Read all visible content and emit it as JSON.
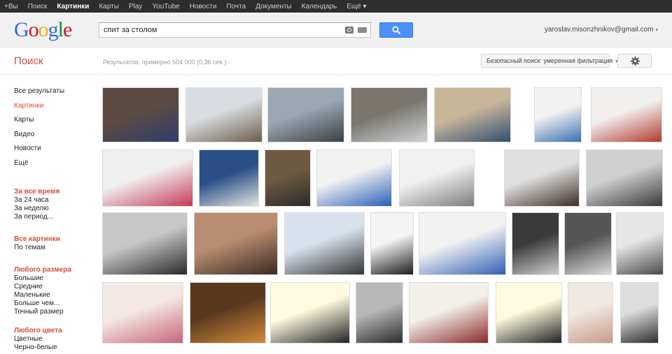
{
  "topbar": {
    "items": [
      {
        "label": "+Вы",
        "active": false
      },
      {
        "label": "Поиск",
        "active": false
      },
      {
        "label": "Картинки",
        "active": true
      },
      {
        "label": "Карты",
        "active": false
      },
      {
        "label": "Play",
        "active": false
      },
      {
        "label": "YouTube",
        "active": false
      },
      {
        "label": "Новости",
        "active": false
      },
      {
        "label": "Почта",
        "active": false
      },
      {
        "label": "Документы",
        "active": false
      },
      {
        "label": "Календарь",
        "active": false
      },
      {
        "label": "Ещё ▾",
        "active": false
      }
    ]
  },
  "header": {
    "logo_letters": [
      "G",
      "o",
      "o",
      "g",
      "l",
      "e"
    ],
    "logo_colors": [
      "#3369e8",
      "#d50f25",
      "#eeb211",
      "#3369e8",
      "#009925",
      "#d50f25"
    ],
    "search_query": "спит за столом",
    "account": "yaroslav.misonzhnikov@gmail.com",
    "account_caret": "▾"
  },
  "subheader": {
    "section_title": "Поиск",
    "result_stats": "Результатов: примерно 504 000 (0,36 сек.)",
    "safe_search": "Безопасный поиск: умеренная фильтрация",
    "safe_search_caret": "▾"
  },
  "sidebar": {
    "nav": [
      {
        "label": "Все результаты",
        "active": false
      },
      {
        "label": "Картинки",
        "active": true
      },
      {
        "label": "Карты",
        "active": false
      },
      {
        "label": "Видео",
        "active": false
      },
      {
        "label": "Новости",
        "active": false
      },
      {
        "label": "Ещё",
        "active": false
      }
    ],
    "filters": [
      {
        "title": "За все время",
        "options": [
          "За 24 часа",
          "За неделю",
          "За период..."
        ]
      },
      {
        "title": "Все картинки",
        "options": [
          "По темам"
        ]
      },
      {
        "title": "Любого размера",
        "options": [
          "Большие",
          "Средние",
          "Маленькие",
          "Больше чем...",
          "Точный размер"
        ]
      },
      {
        "title": "Любого цвета",
        "options": [
          "Цветные",
          "Черно-белые"
        ]
      }
    ]
  },
  "thumbnails": [
    {
      "colors": [
        "#5d4a42",
        "#2f3e6b"
      ]
    },
    {
      "colors": [
        "#d8dbe0",
        "#6b5d4a"
      ]
    },
    {
      "colors": [
        "#9aa7b3",
        "#3b3f44"
      ]
    },
    {
      "colors": [
        "#7a766e",
        "#cfd3d6"
      ]
    },
    {
      "colors": [
        "#c9b59a",
        "#2e4f6e"
      ]
    },
    {
      "colors": [
        "#f2f2f2",
        "#3a6fb0"
      ]
    },
    {
      "colors": [
        "#f1f0ee",
        "#b23b2f"
      ]
    },
    {
      "colors": [
        "#f0f0f0",
        "#c43a5a"
      ]
    },
    {
      "colors": [
        "#2a4f86",
        "#e2e2e2"
      ]
    },
    {
      "colors": [
        "#6e5a42",
        "#2b2b2b"
      ]
    },
    {
      "colors": [
        "#f2f2f2",
        "#2a5db8"
      ]
    },
    {
      "colors": [
        "#f1f1f1",
        "#7d7d7d"
      ]
    },
    {
      "colors": [
        "#e0e0e0",
        "#3d2d25"
      ]
    },
    {
      "colors": [
        "#cfcfcf",
        "#3a3a3a"
      ]
    },
    {
      "colors": [
        "#c7c7c7",
        "#2a2a2a"
      ]
    },
    {
      "colors": [
        "#b98b70",
        "#3a2a22"
      ]
    },
    {
      "colors": [
        "#d9e2ec",
        "#333333"
      ]
    },
    {
      "colors": [
        "#f4f4f4",
        "#1d1d1d"
      ]
    },
    {
      "colors": [
        "#f2f2f2",
        "#2f5fb5"
      ]
    },
    {
      "colors": [
        "#3a3a3a",
        "#cfcfcf"
      ]
    },
    {
      "colors": [
        "#555555",
        "#dcdcdc"
      ]
    },
    {
      "colors": [
        "#e6e6e6",
        "#4a4a4a"
      ]
    },
    {
      "colors": [
        "#f4e8e4",
        "#c7657a"
      ]
    },
    {
      "colors": [
        "#5a3a1e",
        "#d48a3a"
      ]
    },
    {
      "colors": [
        "#fffbe0",
        "#222222"
      ]
    },
    {
      "colors": [
        "#b8b8b8",
        "#2b2b2b"
      ]
    },
    {
      "colors": [
        "#f3f0ea",
        "#8a2a2a"
      ]
    },
    {
      "colors": [
        "#fffbe0",
        "#222222"
      ]
    },
    {
      "colors": [
        "#efe7e2",
        "#c99a86"
      ]
    },
    {
      "colors": [
        "#dcdcdc",
        "#2d2d2d"
      ]
    }
  ]
}
